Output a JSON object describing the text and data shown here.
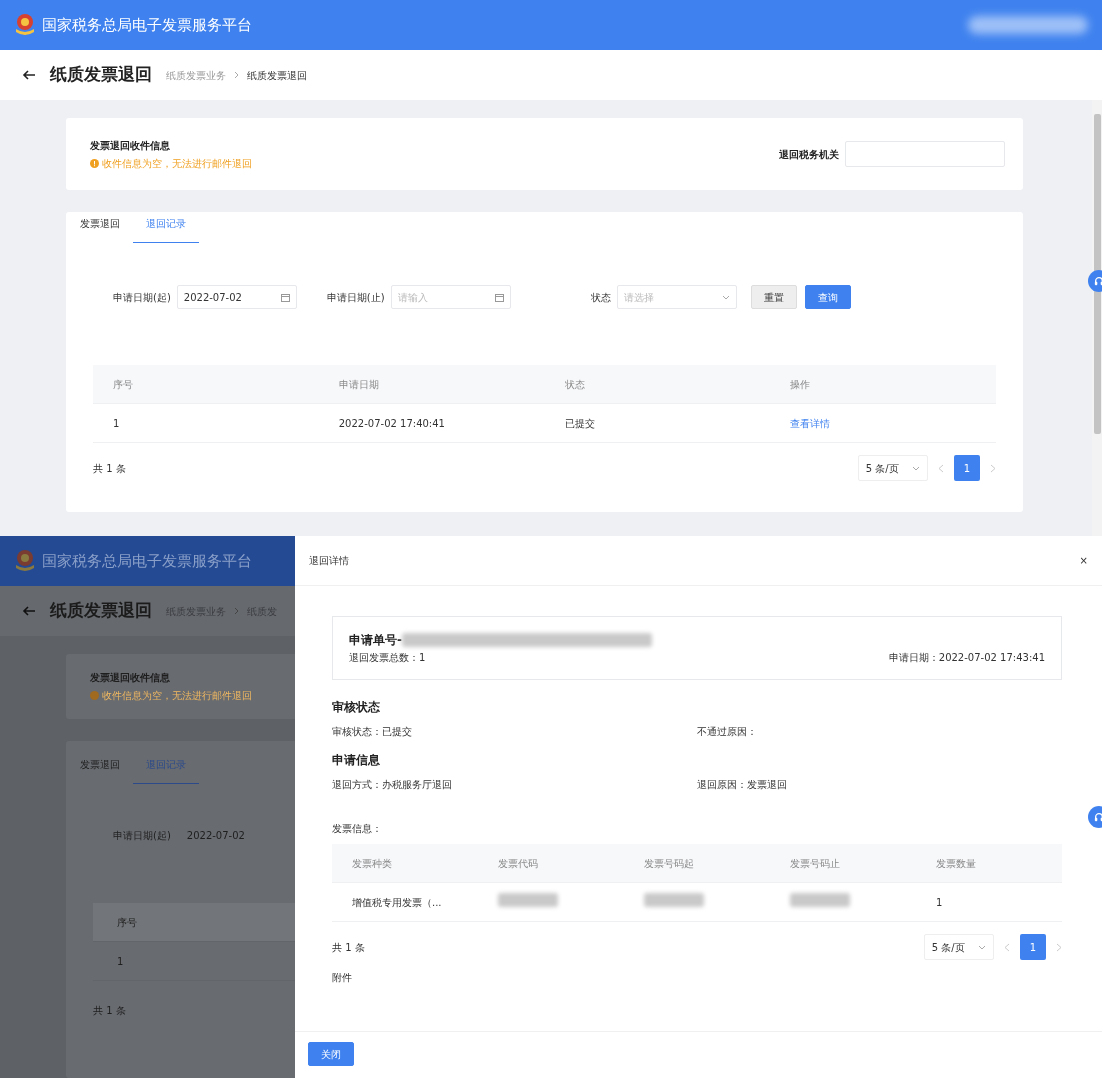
{
  "top_screen": {
    "header": {
      "title": "国家税务总局电子发票服务平台",
      "user_redacted": true
    },
    "page_title": "纸质发票退回",
    "breadcrumb": [
      {
        "label": "纸质发票业务",
        "current": false
      },
      {
        "label": "纸质发票退回",
        "current": true
      }
    ],
    "recipient_card": {
      "title": "发票退回收件信息",
      "warning": "收件信息为空，无法进行邮件退回",
      "field_label": "退回税务机关"
    },
    "tabs": [
      {
        "label": "发票退回",
        "selected": false
      },
      {
        "label": "退回记录",
        "selected": true
      }
    ],
    "filters": [
      {
        "kind": "date",
        "label": "申请日期(起)",
        "value": "2022-07-02"
      },
      {
        "kind": "date",
        "label": "申请日期(止)",
        "placeholder": "请输入"
      },
      {
        "kind": "select",
        "label": "状态",
        "placeholder": "请选择"
      }
    ],
    "buttons": [
      {
        "label": "重置",
        "primary": false
      },
      {
        "label": "查询",
        "primary": true
      }
    ],
    "table": {
      "columns": [
        "序号",
        "申请日期",
        "状态",
        "操作"
      ],
      "rows": [
        [
          {
            "text": "1"
          },
          {
            "text": "2022-07-02 17:40:41"
          },
          {
            "text": "已提交"
          },
          {
            "text": "查看详情",
            "kind": "link"
          }
        ]
      ]
    },
    "pagination": {
      "total": "共 1 条",
      "page_size": "5 条/页",
      "pages": [
        {
          "label": "1",
          "selected": true
        }
      ]
    }
  },
  "bottom_screen": {
    "background_page": {
      "header_title": "国家税务总局电子发票服务平台",
      "page_title": "纸质发票退回",
      "breadcrumb": [
        "纸质发票业务",
        "纸质发"
      ],
      "card_title": "发票退回收件信息",
      "warning": "收件信息为空，无法进行邮件退回",
      "tabs": [
        {
          "label": "发票退回",
          "selected": false
        },
        {
          "label": "退回记录",
          "selected": true
        }
      ],
      "filter_label": "申请日期(起)",
      "filter_value": "2022-07-02",
      "table_column": "序号",
      "table_cell": "1",
      "total": "共 1 条"
    },
    "drawer": {
      "title": "退回详情",
      "close": "×",
      "application": {
        "number_label": "申请单号-",
        "number_redacted": true,
        "count": "退回发票总数：1",
        "date": "申请日期：2022-07-02 17:43:41"
      },
      "sections": [
        {
          "heading": "审核状态",
          "fields": [
            "审核状态：已提交",
            "不通过原因："
          ]
        },
        {
          "heading": "申请信息",
          "fields": [
            "退回方式：办税服务厅退回",
            "退回原因：发票退回"
          ]
        }
      ],
      "invoice_label": "发票信息：",
      "invoice_table": {
        "columns": [
          "发票种类",
          "发票代码",
          "发票号码起",
          "发票号码止",
          "发票数量"
        ],
        "rows": [
          [
            {
              "text": "增值税专用发票（..."
            },
            {
              "redacted": true
            },
            {
              "redacted": true
            },
            {
              "redacted": true
            },
            {
              "text": "1"
            }
          ]
        ]
      },
      "pagination": {
        "total": "共 1 条",
        "page_size": "5 条/页",
        "pages": [
          {
            "label": "1",
            "selected": true
          }
        ]
      },
      "attachment_label": "附件",
      "footer_button": "关闭"
    }
  }
}
